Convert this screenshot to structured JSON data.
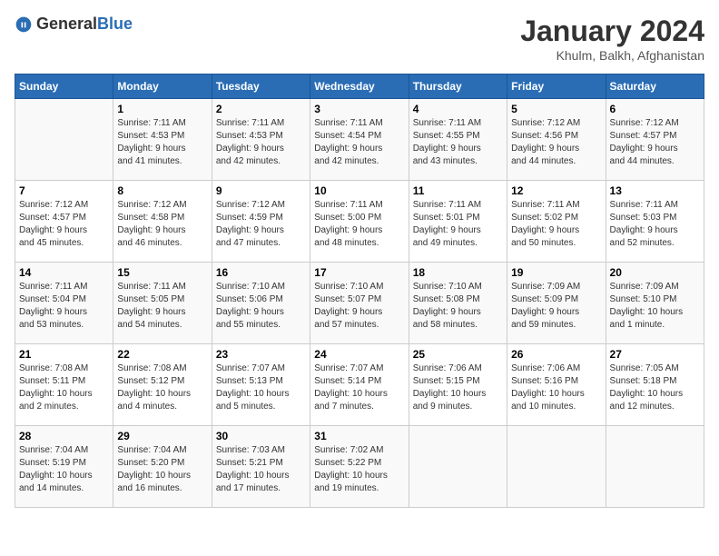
{
  "header": {
    "logo_general": "General",
    "logo_blue": "Blue",
    "month": "January 2024",
    "location": "Khulm, Balkh, Afghanistan"
  },
  "columns": [
    "Sunday",
    "Monday",
    "Tuesday",
    "Wednesday",
    "Thursday",
    "Friday",
    "Saturday"
  ],
  "weeks": [
    [
      {
        "day": "",
        "info": ""
      },
      {
        "day": "1",
        "info": "Sunrise: 7:11 AM\nSunset: 4:53 PM\nDaylight: 9 hours\nand 41 minutes."
      },
      {
        "day": "2",
        "info": "Sunrise: 7:11 AM\nSunset: 4:53 PM\nDaylight: 9 hours\nand 42 minutes."
      },
      {
        "day": "3",
        "info": "Sunrise: 7:11 AM\nSunset: 4:54 PM\nDaylight: 9 hours\nand 42 minutes."
      },
      {
        "day": "4",
        "info": "Sunrise: 7:11 AM\nSunset: 4:55 PM\nDaylight: 9 hours\nand 43 minutes."
      },
      {
        "day": "5",
        "info": "Sunrise: 7:12 AM\nSunset: 4:56 PM\nDaylight: 9 hours\nand 44 minutes."
      },
      {
        "day": "6",
        "info": "Sunrise: 7:12 AM\nSunset: 4:57 PM\nDaylight: 9 hours\nand 44 minutes."
      }
    ],
    [
      {
        "day": "7",
        "info": "Sunrise: 7:12 AM\nSunset: 4:57 PM\nDaylight: 9 hours\nand 45 minutes."
      },
      {
        "day": "8",
        "info": "Sunrise: 7:12 AM\nSunset: 4:58 PM\nDaylight: 9 hours\nand 46 minutes."
      },
      {
        "day": "9",
        "info": "Sunrise: 7:12 AM\nSunset: 4:59 PM\nDaylight: 9 hours\nand 47 minutes."
      },
      {
        "day": "10",
        "info": "Sunrise: 7:11 AM\nSunset: 5:00 PM\nDaylight: 9 hours\nand 48 minutes."
      },
      {
        "day": "11",
        "info": "Sunrise: 7:11 AM\nSunset: 5:01 PM\nDaylight: 9 hours\nand 49 minutes."
      },
      {
        "day": "12",
        "info": "Sunrise: 7:11 AM\nSunset: 5:02 PM\nDaylight: 9 hours\nand 50 minutes."
      },
      {
        "day": "13",
        "info": "Sunrise: 7:11 AM\nSunset: 5:03 PM\nDaylight: 9 hours\nand 52 minutes."
      }
    ],
    [
      {
        "day": "14",
        "info": "Sunrise: 7:11 AM\nSunset: 5:04 PM\nDaylight: 9 hours\nand 53 minutes."
      },
      {
        "day": "15",
        "info": "Sunrise: 7:11 AM\nSunset: 5:05 PM\nDaylight: 9 hours\nand 54 minutes."
      },
      {
        "day": "16",
        "info": "Sunrise: 7:10 AM\nSunset: 5:06 PM\nDaylight: 9 hours\nand 55 minutes."
      },
      {
        "day": "17",
        "info": "Sunrise: 7:10 AM\nSunset: 5:07 PM\nDaylight: 9 hours\nand 57 minutes."
      },
      {
        "day": "18",
        "info": "Sunrise: 7:10 AM\nSunset: 5:08 PM\nDaylight: 9 hours\nand 58 minutes."
      },
      {
        "day": "19",
        "info": "Sunrise: 7:09 AM\nSunset: 5:09 PM\nDaylight: 9 hours\nand 59 minutes."
      },
      {
        "day": "20",
        "info": "Sunrise: 7:09 AM\nSunset: 5:10 PM\nDaylight: 10 hours\nand 1 minute."
      }
    ],
    [
      {
        "day": "21",
        "info": "Sunrise: 7:08 AM\nSunset: 5:11 PM\nDaylight: 10 hours\nand 2 minutes."
      },
      {
        "day": "22",
        "info": "Sunrise: 7:08 AM\nSunset: 5:12 PM\nDaylight: 10 hours\nand 4 minutes."
      },
      {
        "day": "23",
        "info": "Sunrise: 7:07 AM\nSunset: 5:13 PM\nDaylight: 10 hours\nand 5 minutes."
      },
      {
        "day": "24",
        "info": "Sunrise: 7:07 AM\nSunset: 5:14 PM\nDaylight: 10 hours\nand 7 minutes."
      },
      {
        "day": "25",
        "info": "Sunrise: 7:06 AM\nSunset: 5:15 PM\nDaylight: 10 hours\nand 9 minutes."
      },
      {
        "day": "26",
        "info": "Sunrise: 7:06 AM\nSunset: 5:16 PM\nDaylight: 10 hours\nand 10 minutes."
      },
      {
        "day": "27",
        "info": "Sunrise: 7:05 AM\nSunset: 5:18 PM\nDaylight: 10 hours\nand 12 minutes."
      }
    ],
    [
      {
        "day": "28",
        "info": "Sunrise: 7:04 AM\nSunset: 5:19 PM\nDaylight: 10 hours\nand 14 minutes."
      },
      {
        "day": "29",
        "info": "Sunrise: 7:04 AM\nSunset: 5:20 PM\nDaylight: 10 hours\nand 16 minutes."
      },
      {
        "day": "30",
        "info": "Sunrise: 7:03 AM\nSunset: 5:21 PM\nDaylight: 10 hours\nand 17 minutes."
      },
      {
        "day": "31",
        "info": "Sunrise: 7:02 AM\nSunset: 5:22 PM\nDaylight: 10 hours\nand 19 minutes."
      },
      {
        "day": "",
        "info": ""
      },
      {
        "day": "",
        "info": ""
      },
      {
        "day": "",
        "info": ""
      }
    ]
  ]
}
